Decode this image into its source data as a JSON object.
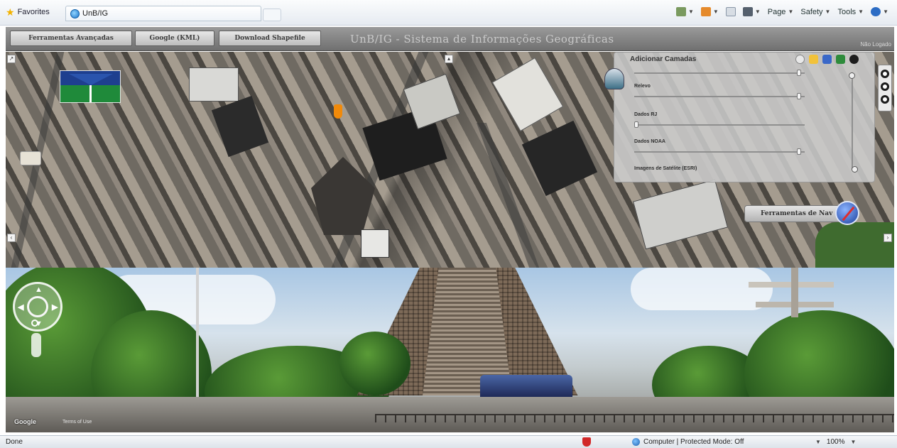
{
  "browser": {
    "favorites_label": "Favorites",
    "tab_label": "UnB/IG",
    "tools": [
      {
        "label": "",
        "icon": "home-icon"
      },
      {
        "label": "",
        "icon": "feeds-icon"
      },
      {
        "label": "",
        "icon": "mail-icon"
      },
      {
        "label": "",
        "icon": "print-icon"
      },
      {
        "label": "Page",
        "icon": ""
      },
      {
        "label": "Safety",
        "icon": ""
      },
      {
        "label": "Tools",
        "icon": ""
      },
      {
        "label": "",
        "icon": "help-icon"
      }
    ]
  },
  "app": {
    "buttons": [
      "Ferramentas Avançadas",
      "Google (KML)",
      "Download Shapefile"
    ],
    "title": "UnB/IG - Sistema de Informações Geográficas",
    "login_status": "Não Logado"
  },
  "layers_panel": {
    "title": "Adicionar Camadas",
    "layers": [
      {
        "label": "",
        "opacity": 0.98
      },
      {
        "label": "Relevo",
        "opacity": 0.98
      },
      {
        "label": "Dados RJ",
        "opacity": 0.0
      },
      {
        "label": "Dados NOAA",
        "opacity": 0.98
      },
      {
        "label": "Imagens de Satélite (ESRI)",
        "opacity": 0.98
      }
    ],
    "nav_tools_label": "Ferramentas de Nav"
  },
  "street_view": {
    "google_label": "Google",
    "terms_label": "Terms of Use"
  },
  "status": {
    "left": "Done",
    "zone": "Computer | Protected Mode: Off",
    "zoom": "100%"
  },
  "colors": {
    "app_header": "#8a8a8a",
    "unb_blue": "#1e3f8f",
    "unb_green": "#1f8a3a",
    "pin_orange": "#f18a0a"
  }
}
